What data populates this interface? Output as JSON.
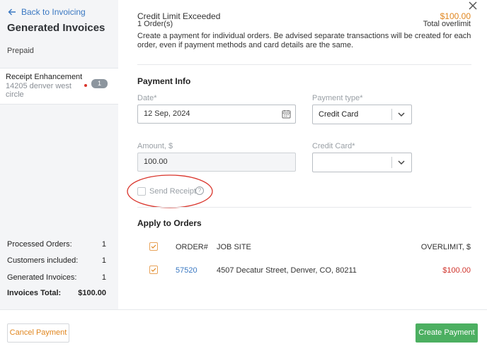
{
  "sidebar": {
    "back_label": "Back to Invoicing",
    "title": "Generated Invoices",
    "prepaid_label": "Prepaid",
    "card": {
      "title": "Receipt Enhancement",
      "subtitle": "14205 denver west circle",
      "badge_count": "1"
    },
    "stats": [
      {
        "label": "Processed Orders:",
        "value": "1"
      },
      {
        "label": "Customers included:",
        "value": "1"
      },
      {
        "label": "Generated Invoices:",
        "value": "1"
      },
      {
        "label": "Invoices Total:",
        "value": "$100.00"
      }
    ]
  },
  "header": {
    "limit_title": "Credit Limit Exceeded",
    "orders_count": "1 Order(s)",
    "overlimit_amount": "$100.00",
    "overlimit_label": "Total overlimit",
    "description": "Create a payment for individual orders. Be advised separate transactions will be created for each order, even if payment methods and card details are the same."
  },
  "payment_info": {
    "title": "Payment Info",
    "date_label": "Date*",
    "date_value": "12 Sep, 2024",
    "payment_type_label": "Payment type*",
    "payment_type_value": "Credit Card",
    "amount_label": "Amount, $",
    "amount_value": "100.00",
    "credit_card_label": "Credit Card*",
    "credit_card_value": "",
    "send_receipt_label": "Send Receipt",
    "send_receipt_checked": false,
    "help_glyph": "?"
  },
  "apply_orders": {
    "title": "Apply to Orders",
    "columns": [
      "ORDER#",
      "JOB SITE",
      "OVERLIMIT, $"
    ],
    "rows": [
      {
        "order": "57520",
        "job_site": "4507 Decatur Street, Denver, CO, 80211",
        "overlimit": "$100.00",
        "checked": true
      }
    ]
  },
  "footer": {
    "cancel_label": "Cancel Payment",
    "create_label": "Create Payment"
  },
  "colors": {
    "accent_orange": "#e0861f",
    "link_blue": "#3a78c2",
    "success_green": "#4caf61",
    "annotation_red": "#d9342b"
  }
}
